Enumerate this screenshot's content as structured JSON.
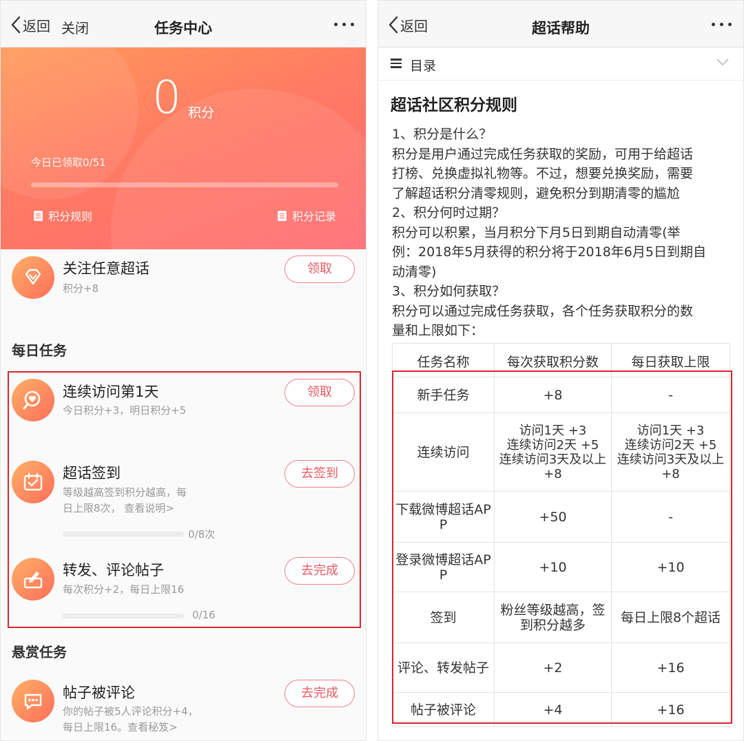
{
  "left": {
    "nav": {
      "back_label": "返回",
      "close_label": "关闭",
      "title": "任务中心"
    },
    "hero": {
      "points": "0",
      "points_unit": "积分",
      "progress_text": "今日已领取0/51",
      "progress_fraction": 0,
      "rules_link": "积分规则",
      "records_link": "积分记录"
    },
    "follow_task": {
      "title": "关注任意超话",
      "desc": "积分+8",
      "button": "领取"
    },
    "daily_section_title": "每日任务",
    "daily_tasks": [
      {
        "title": "连续访问第1天",
        "desc": "今日积分+3，明日积分+5",
        "button": "领取"
      },
      {
        "title": "超话签到",
        "desc_line1": "等级越高签到积分越高，每",
        "desc_line2": "日上限8次，  查看说明>",
        "button": "去签到",
        "progress": "0/8次",
        "progress_fraction": 0
      },
      {
        "title": "转发、评论帖子",
        "desc": "每次积分+2，每日上限16",
        "button": "去完成",
        "progress": "0/16",
        "progress_fraction": 0
      }
    ],
    "reward_section_title": "悬赏任务",
    "reward_tasks": [
      {
        "title": "帖子被评论",
        "desc_line1": "你的帖子被5人评论积分+4，",
        "desc_line2": "每日上限16。查看秘笈>",
        "button": "去完成"
      }
    ],
    "colors": {
      "hero_start": "#ff9a5a",
      "hero_end": "#ff6b72",
      "button_text": "#ec5a62",
      "highlight_box": "#d9262c"
    }
  },
  "right": {
    "nav": {
      "back_label": "返回",
      "title": "超话帮助"
    },
    "toc_label": "目录",
    "article_title": "超话社区积分规则",
    "paragraphs": [
      "1、积分是什么？",
      "积分是用户通过完成任务获取的奖励，可用于给超话",
      "打榜、兑换虚拟礼物等。不过，想要兑换奖励，需要",
      "了解超话积分清零规则，避免积分到期清零的尴尬",
      "2、积分何时过期？",
      "积分可以积累，当月积分下月5日到期自动清零(举",
      "例：2018年5月获得的积分将于2018年6月5日到期自",
      "动清零)",
      "3、积分如何获取？",
      "积分可以通过完成任务获取，各个任务获取积分的数",
      "量和上限如下："
    ],
    "table": {
      "headers": [
        "任务名称",
        "每次获取积分数",
        "每日获取上限"
      ],
      "rows": [
        [
          "新手任务",
          "+8",
          "-"
        ],
        [
          "连续访问",
          "访问1天 +3\n连续访问2天 +5\n连续访问3天及以上 +8",
          "访问1天 +3\n连续访问2天 +5\n连续访问3天及以上 +8"
        ],
        [
          "下载微博超话APP",
          "+50",
          "-"
        ],
        [
          "登录微博超话APP",
          "+10",
          "+10"
        ],
        [
          "签到",
          "粉丝等级越高，签到积分越多",
          "每日上限8个超话"
        ],
        [
          "评论、转发帖子",
          "+2",
          "+16"
        ],
        [
          "帖子被评论",
          "+4",
          "+16"
        ]
      ]
    }
  }
}
